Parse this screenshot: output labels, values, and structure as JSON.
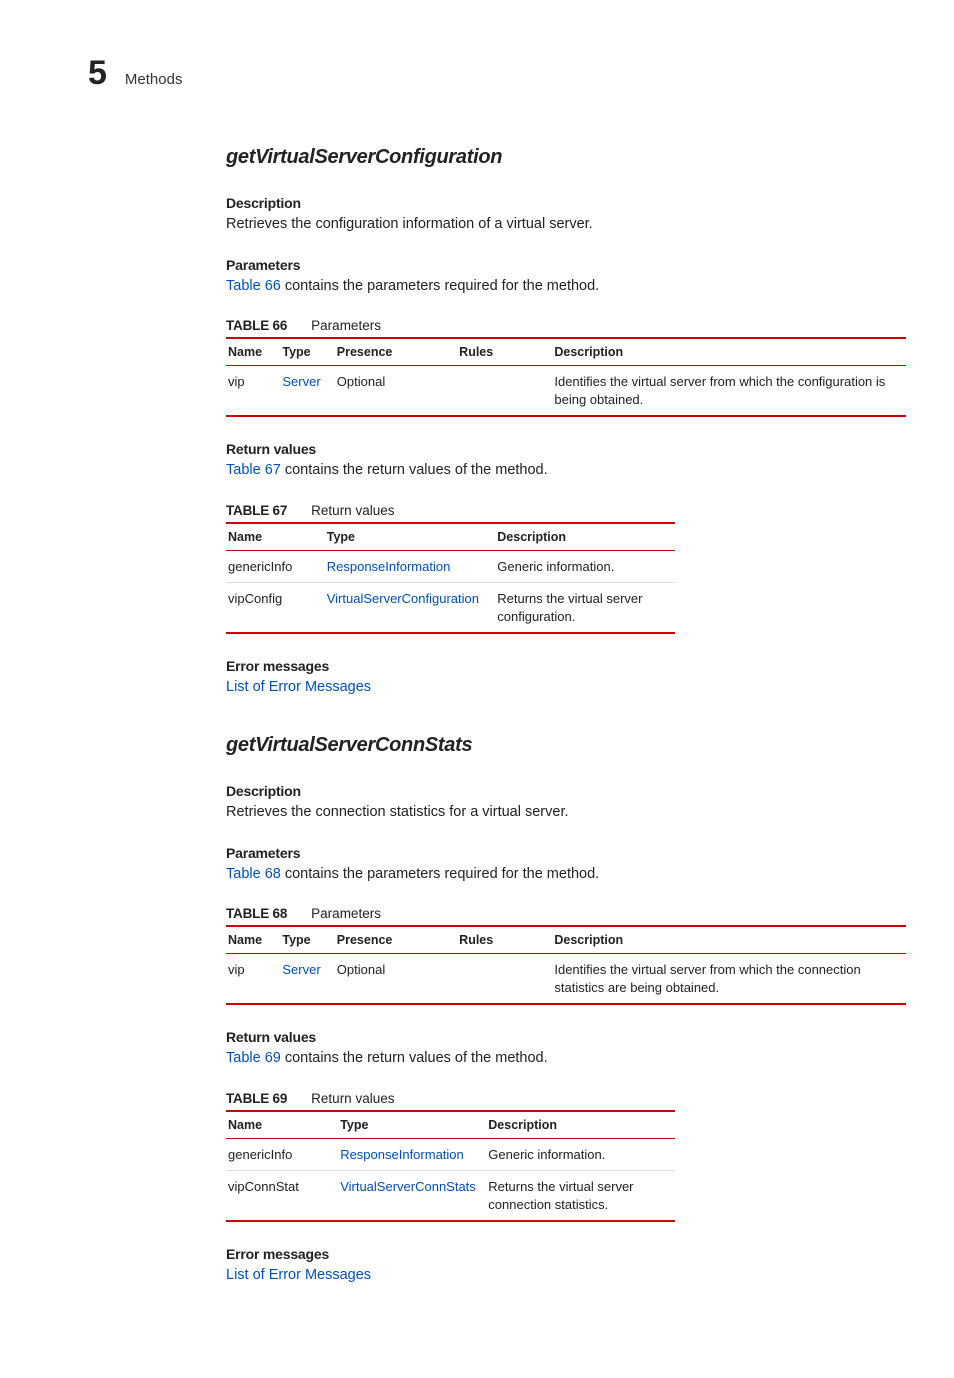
{
  "page": {
    "chapter_number": "5",
    "chapter_label": "Methods"
  },
  "methods": [
    {
      "title": "getVirtualServerConfiguration",
      "description_heading": "Description",
      "description_text": "Retrieves the configuration information of a virtual server.",
      "parameters_heading": "Parameters",
      "parameters_intro_prefix": "Table 66",
      "parameters_intro_suffix": " contains the parameters required for the method.",
      "parameters_table": {
        "caption_label": "TABLE 66",
        "caption_text": "Parameters",
        "headers": [
          "Name",
          "Type",
          "Presence",
          "Rules",
          "Description"
        ],
        "rows": [
          {
            "name": "vip",
            "type": "Server",
            "type_is_link": true,
            "presence": "Optional",
            "rules": "",
            "description": "Identifies the virtual server from which the configuration is being obtained."
          }
        ]
      },
      "return_heading": "Return values",
      "return_intro_prefix": "Table 67",
      "return_intro_suffix": " contains the return values of the method.",
      "return_table": {
        "caption_label": "TABLE 67",
        "caption_text": "Return values",
        "headers": [
          "Name",
          "Type",
          "Description"
        ],
        "rows": [
          {
            "name": "genericInfo",
            "type": "ResponseInformation",
            "type_is_link": true,
            "description": "Generic information."
          },
          {
            "name": "vipConfig",
            "type": "VirtualServerConfiguration",
            "type_is_link": true,
            "description": "Returns the virtual server configuration."
          }
        ]
      },
      "error_heading": "Error messages",
      "error_link": "List of Error Messages"
    },
    {
      "title": "getVirtualServerConnStats",
      "description_heading": "Description",
      "description_text": "Retrieves the connection statistics for a virtual server.",
      "parameters_heading": "Parameters",
      "parameters_intro_prefix": "Table 68",
      "parameters_intro_suffix": " contains the parameters required for the method.",
      "parameters_table": {
        "caption_label": "TABLE 68",
        "caption_text": "Parameters",
        "headers": [
          "Name",
          "Type",
          "Presence",
          "Rules",
          "Description"
        ],
        "rows": [
          {
            "name": "vip",
            "type": "Server",
            "type_is_link": true,
            "presence": "Optional",
            "rules": "",
            "description": "Identifies the virtual server from which the connection statistics are being obtained."
          }
        ]
      },
      "return_heading": "Return values",
      "return_intro_prefix": "Table 69",
      "return_intro_suffix": " contains the return values of the method.",
      "return_table": {
        "caption_label": "TABLE 69",
        "caption_text": "Return values",
        "headers": [
          "Name",
          "Type",
          "Description"
        ],
        "rows": [
          {
            "name": "genericInfo",
            "type": "ResponseInformation",
            "type_is_link": true,
            "description": "Generic information."
          },
          {
            "name": "vipConnStat",
            "type": "VirtualServerConnStats",
            "type_is_link": true,
            "description": "Returns the virtual server connection statistics."
          }
        ]
      },
      "error_heading": "Error messages",
      "error_link": "List of Error Messages"
    }
  ]
}
